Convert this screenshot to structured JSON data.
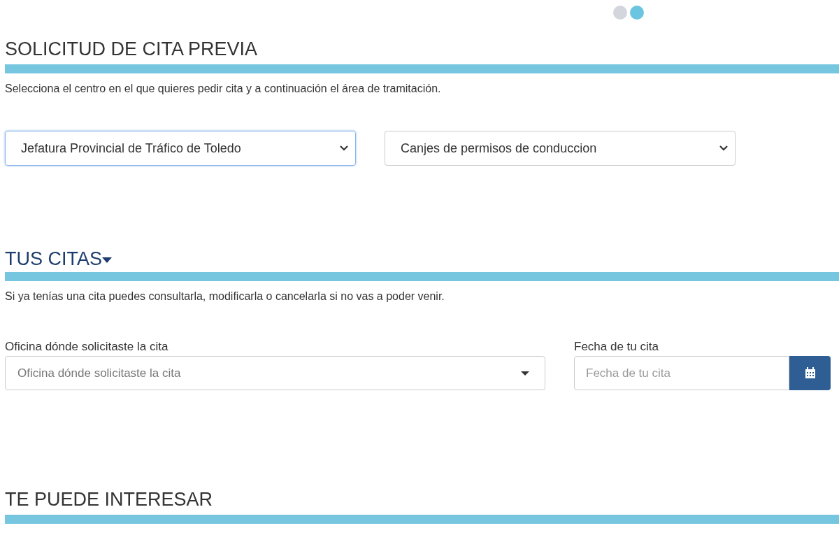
{
  "pager": [
    {
      "selected": false
    },
    {
      "selected": true
    }
  ],
  "appointment_request": {
    "title": "SOLICITUD DE CITA PREVIA",
    "description": "Selecciona el centro en el que quieres pedir cita y a continuación el área de tramitación.",
    "selects": [
      {
        "value": "Jefatura Provincial de Tráfico de Toledo",
        "focused": true
      },
      {
        "value": "Canjes de permisos de conduccion",
        "focused": false
      }
    ]
  },
  "your_appointments": {
    "title": "TUS CITAS",
    "expanded": true,
    "description": "Si ya tenías una cita puedes consultarla, modificarla o cancelarla si no vas a poder venir.",
    "office": {
      "label": "Oficina dónde solicitaste la cita",
      "placeholder": "Oficina dónde solicitaste la cita"
    },
    "date": {
      "label": "Fecha de tu cita",
      "placeholder": "Fecha de tu cita"
    }
  },
  "may_interest": {
    "title": "TE PUEDE INTERESAR"
  }
}
